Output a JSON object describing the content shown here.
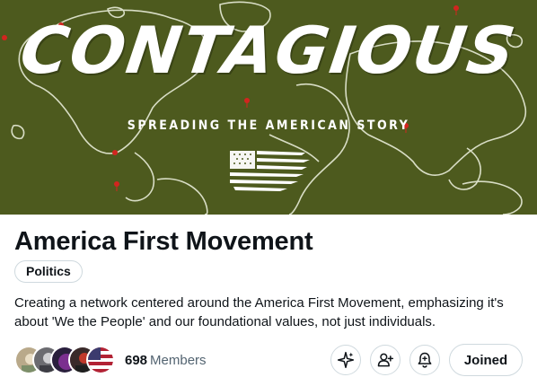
{
  "banner": {
    "title": "CONTAGIOUS",
    "subtitle": "SPREADING THE AMERICAN STORY",
    "background_color": "#4d5a1e"
  },
  "community": {
    "name": "America First Movement",
    "topic_tag": "Politics",
    "description": "Creating a network centered around the America First Movement, emphasizing it's about 'We the People' and our foundational values, not just individuals.",
    "member_count": "698",
    "members_label": "Members"
  },
  "actions": {
    "grok_icon": "sparkle-icon",
    "invite_icon": "add-user-icon",
    "notifications_icon": "bell-plus-icon",
    "joined_label": "Joined"
  }
}
